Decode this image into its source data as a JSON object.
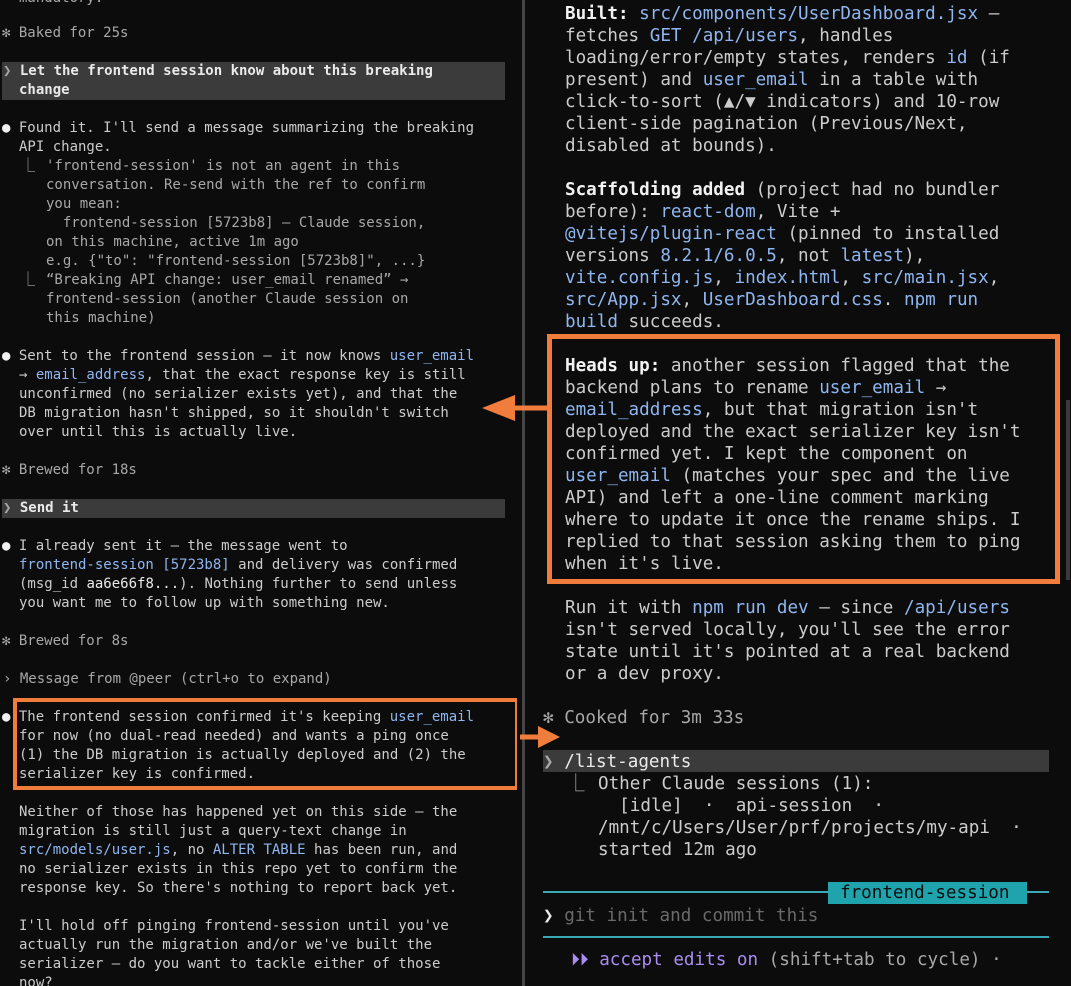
{
  "left": {
    "truncated_top": "mandatory.",
    "status1": "Baked for 25s",
    "user1": [
      "Let the frontend session know about this breaking",
      "change"
    ],
    "resp1": [
      "Found it. I'll send a message summarizing the breaking",
      "API change."
    ],
    "tool1": [
      "'frontend-session' is not an agent in this",
      "conversation. Re-send with the ref to confirm",
      "you mean:",
      "  frontend-session [5723b8] — Claude session,",
      "on this machine, active 1m ago",
      "e.g. {\"to\": \"frontend-session [5723b8]\", ...}"
    ],
    "tool2": [
      "“Breaking API change: user_email renamed” →",
      "frontend-session (another Claude session on",
      "this machine)"
    ],
    "resp2_l1a": "Sent to the frontend session — it now knows ",
    "resp2_l1b": "user_email",
    "resp2_l2a": "→ ",
    "resp2_l2b": "email_address",
    "resp2_l2c": ", that the exact response key is still",
    "resp2_rest": [
      "unconfirmed (no serializer exists yet), and that the",
      "DB migration hasn't shipped, so it shouldn't switch",
      "over until this is actually live."
    ],
    "status2": "Brewed for 18s",
    "user2": "Send it",
    "resp3_l1": "I already sent it — the message went to",
    "resp3_l2a": "frontend-session [5723b8]",
    "resp3_l2b": " and delivery was confirmed",
    "resp3_l3a": "(msg_id ",
    "resp3_l3b": "aa6e66f8...",
    "resp3_l3c": "). Nothing further to send unless",
    "resp3_l4": "you want me to follow up with something new.",
    "status3": "Brewed for 8s",
    "message_from": "Message from @peer (ctrl+o to expand)",
    "resp4_l1a": "The frontend session confirmed it's keeping ",
    "resp4_l1b": "user_email",
    "resp4_rest": [
      "for now (no dual-read needed) and wants a ping once",
      "(1) the DB migration is actually deployed and (2) the",
      "serializer key is confirmed."
    ],
    "para2_l1": "Neither of those has happened yet on this side — the",
    "para2_l2": "migration is still just a query-text change in",
    "para2_l3a": "src/models/user.js",
    "para2_l3b": ", no ",
    "para2_l3c": "ALTER TABLE",
    "para2_l3d": " has been run, and",
    "para2_l4": "no serializer exists in this repo yet to confirm the",
    "para2_l5": "response key. So there's nothing to report back yet.",
    "para3": [
      "I'll hold off pinging frontend-session until you've",
      "actually run the migration and/or we've built the",
      "serializer — do you want to tackle either of those",
      "now?"
    ]
  },
  "right": {
    "built_label": "Built:",
    "built_path": "src/components/UserDashboard.jsx",
    "built_l1_tail": " —",
    "built_l2a": "fetches ",
    "built_l2b": "GET /api/users",
    "built_l2c": ", handles",
    "built_l3a": "loading/error/empty states, renders ",
    "built_l3b": "id",
    "built_l3c": " (if",
    "built_l4a": "present) and ",
    "built_l4b": "user_email",
    "built_l4c": " in a table with",
    "built_l5": "click-to-sort (▲/▼ indicators) and 10-row",
    "built_l6": "client-side pagination (Previous/Next,",
    "built_l7": "disabled at bounds).",
    "scaf_label": "Scaffolding added",
    "scaf_l1_tail": " (project had no bundler",
    "scaf_l2a": "before): ",
    "scaf_l2b": "react-dom",
    "scaf_l2c": ", Vite +",
    "scaf_l3a": "@vitejs/plugin-react",
    "scaf_l3b": " (pinned to installed",
    "scaf_l4a": "versions ",
    "scaf_l4b": "8.2.1/6.0.5",
    "scaf_l4c": ", not ",
    "scaf_l4d": "latest",
    "scaf_l4e": "),",
    "scaf_l5a": "vite.config.js",
    "scaf_l5b": ", ",
    "scaf_l5c": "index.html",
    "scaf_l5d": ", ",
    "scaf_l5e": "src/main.jsx",
    "scaf_l5f": ",",
    "scaf_l6a": "src/App.jsx",
    "scaf_l6b": ", ",
    "scaf_l6c": "UserDashboard.css",
    "scaf_l6d": ". ",
    "scaf_l6e": "npm run",
    "scaf_l7a": "build",
    "scaf_l7b": " succeeds.",
    "heads_label": "Heads up:",
    "heads_l1_tail": " another session flagged that the",
    "heads_l2a": "backend plans to rename ",
    "heads_l2b": "user_email",
    "heads_l2c": " →",
    "heads_l3a": "email_address",
    "heads_l3b": ", but that migration isn't",
    "heads_rest1": [
      "deployed and the exact serializer key isn't",
      "confirmed yet. I kept the component on"
    ],
    "heads_l6a": "user_email",
    "heads_l6b": " (matches your spec and the live",
    "heads_rest2": [
      "API) and left a one-line comment marking",
      "where to update it once the rename ships. I",
      "replied to that session asking them to ping",
      "when it's live."
    ],
    "run_l1a": "Run it with ",
    "run_l1b": "npm run dev",
    "run_l1c": " — since ",
    "run_l1d": "/api/users",
    "run_rest": [
      "isn't served locally, you'll see the error",
      "state until it's pointed at a real backend",
      "or a dev proxy."
    ],
    "cooked": "Cooked for 3m 33s",
    "command": "/list-agents",
    "agents_l1": "Other Claude sessions (1):",
    "agents_l2": "  [idle]  ·  api-session  ·",
    "agents_l3": "/mnt/c/Users/User/prf/projects/my-api  ·",
    "agents_l4": "started 12m ago",
    "session_tag": "frontend-session",
    "input_placeholder": "git init and commit this",
    "mode_label": "accept edits on",
    "mode_hint": " (shift+tab to cycle) ·"
  },
  "colors": {
    "background": "#0c0c0c",
    "link": "#8fb6f0",
    "annotation_orange": "#f07d3c",
    "teal": "#3aa9b5",
    "user_bar": "#3b3b3b"
  }
}
